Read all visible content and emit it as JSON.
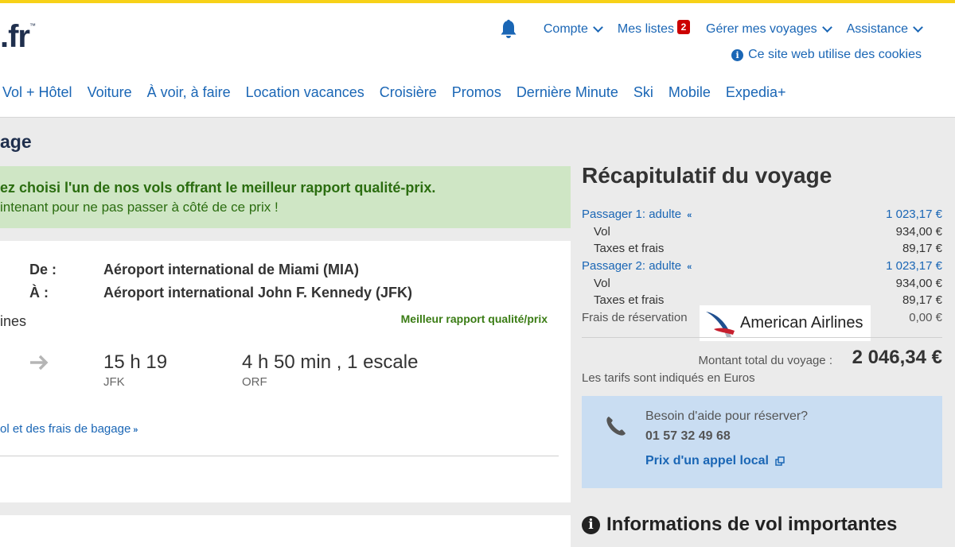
{
  "header": {
    "logo_text": ".fr",
    "logo_tm": "™",
    "util_nav": {
      "account": "Compte",
      "lists": "Mes listes",
      "lists_badge": "2",
      "manage": "Gérer mes voyages",
      "help": "Assistance"
    },
    "cookie_notice": "Ce site web utilise des cookies",
    "main_nav": [
      "Vol + Hôtel",
      "Voiture",
      "À voir, à faire",
      "Location vacances",
      "Croisière",
      "Promos",
      "Dernière Minute",
      "Ski",
      "Mobile",
      "Expedia+"
    ],
    "icons": {
      "bell": "bell-icon",
      "info": "info-icon",
      "chevron": "chevron-down-icon"
    },
    "accent_color": "#f7d117"
  },
  "main": {
    "page_title": "age",
    "promo": {
      "line1": "ez choisi l'un de nos vols offrant le meilleur rapport qualité-prix.",
      "line2": "intenant pour ne pas passer à côté de ce prix !"
    },
    "flight": {
      "from_label": "De :",
      "from_value": "Aéroport international de Miami (MIA)",
      "to_label": "À :",
      "to_value": "Aéroport international John F. Kennedy (JFK)",
      "airline_partial": "ines",
      "best_value_tag": "Meilleur rapport qualité/prix",
      "arrival_time": "15 h 19",
      "arrival_code": "JFK",
      "duration": "4 h  50 min , 1 escale",
      "stop_code": "ORF",
      "baggage_link": "ol et des frais de bagage"
    }
  },
  "recap": {
    "title": "Récapitulatif du voyage",
    "passenger1": {
      "label": "Passager 1: adulte",
      "total": "1 023,17 €",
      "flight_label": "Vol",
      "flight_amount": "934,00 €",
      "tax_label": "Taxes et frais",
      "tax_amount": "89,17 €"
    },
    "passenger2": {
      "label": "Passager 2: adulte",
      "total": "1 023,17 €",
      "flight_label": "Vol",
      "flight_amount": "934,00 €",
      "tax_label": "Taxes et frais",
      "tax_amount": "89,17 €"
    },
    "booking_fee_label": "Frais de réservation",
    "booking_fee_amount": "0,00 €",
    "airline_logo_text": "American Airlines",
    "total_label": "Montant total du voyage :",
    "total_amount": "2 046,34 €",
    "currency_note": "Les tarifs sont indiqués en Euros"
  },
  "help": {
    "question": "Besoin d'aide pour réserver?",
    "phone": "01 57 32 49 68",
    "link": "Prix d'un appel local",
    "icons": {
      "phone": "phone-icon",
      "external": "external-link-icon"
    }
  },
  "important": {
    "title": "Informations de vol importantes"
  }
}
